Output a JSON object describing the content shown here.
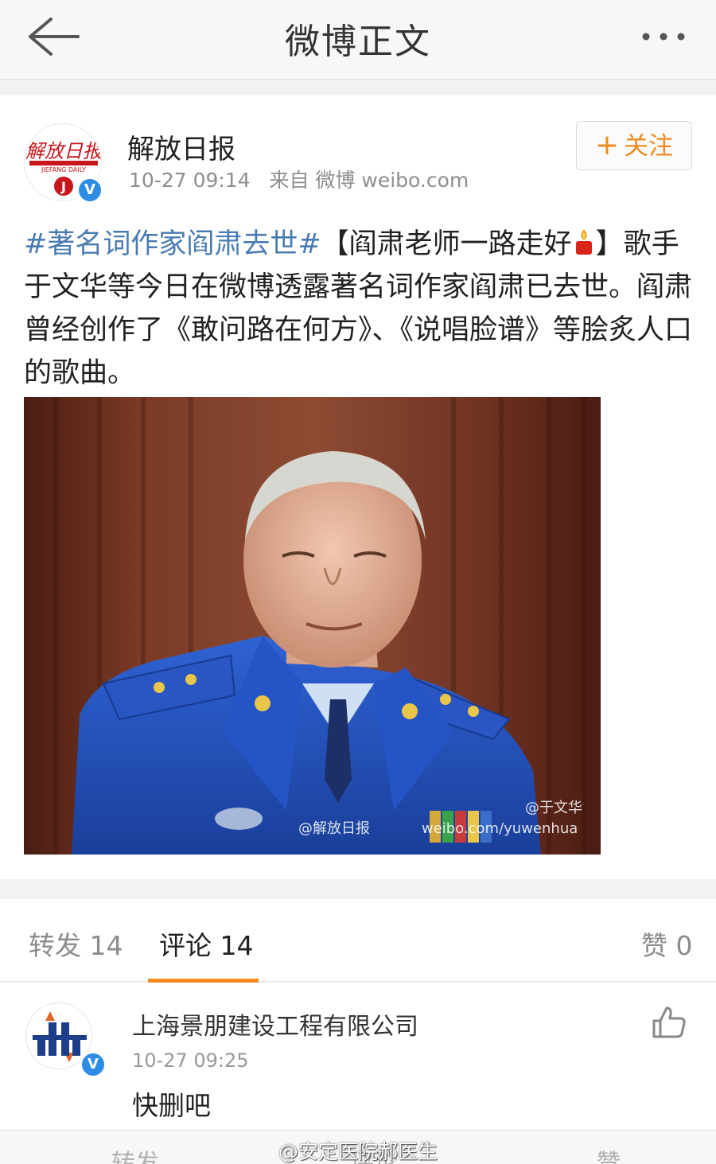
{
  "header": {
    "title": "微博正文",
    "back_icon": "back-arrow-icon",
    "more_icon": "more-dots-icon"
  },
  "post": {
    "author": "解放日报",
    "avatar_icon": "jiefang-daily-logo",
    "verified_icon": "verified-badge-icon",
    "timestamp": "10-27 09:14",
    "source": "来自 微博 weibo.com",
    "follow_label": "关注",
    "follow_plus": "+",
    "hashtag": "#著名词作家阎肃去世#",
    "bracket_open": "【阎肃老师一路走好",
    "bracket_close": "】",
    "body": "歌手于文华等今日在微博透露著名词作家阎肃已去世。阎肃曾经创作了《敢问路在何方》、《说唱脸谱》等脍炙人口的歌曲。",
    "image_watermark_left": "@解放日报",
    "image_watermark_right_top": "@于文华",
    "image_watermark_right_bottom": "weibo.com/yuwenhua"
  },
  "tabs": [
    {
      "label": "转发 14"
    },
    {
      "label": "评论 14"
    },
    {
      "label": "赞 0"
    }
  ],
  "comment": {
    "author": "上海景朋建设工程有限公司",
    "time": "10-27 09:25",
    "text": "快删吧",
    "like_icon": "thumbs-up-icon"
  },
  "toolbar": {
    "items": [
      "转发",
      "评论",
      "赞"
    ]
  },
  "watermark": "@安定医院郝医生",
  "colors": {
    "accent": "#f18b21",
    "link": "#4b7cb1",
    "verified": "#2d8de6"
  }
}
